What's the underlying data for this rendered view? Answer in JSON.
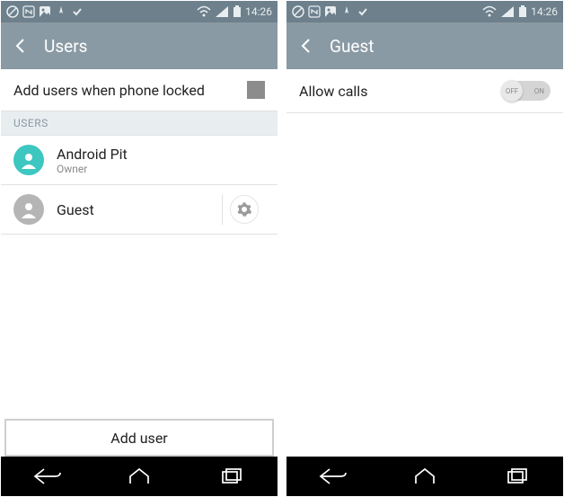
{
  "left": {
    "status": {
      "time": "14:26"
    },
    "header": {
      "title": "Users"
    },
    "add_locked": {
      "label": "Add users when phone locked"
    },
    "section": "USERS",
    "users": [
      {
        "name": "Android Pit",
        "sub": "Owner"
      },
      {
        "name": "Guest"
      }
    ],
    "add_user": "Add user"
  },
  "right": {
    "status": {
      "time": "14:26"
    },
    "header": {
      "title": "Guest"
    },
    "allow_calls": {
      "label": "Allow calls"
    },
    "toggle": {
      "off": "OFF",
      "on": "ON"
    }
  }
}
